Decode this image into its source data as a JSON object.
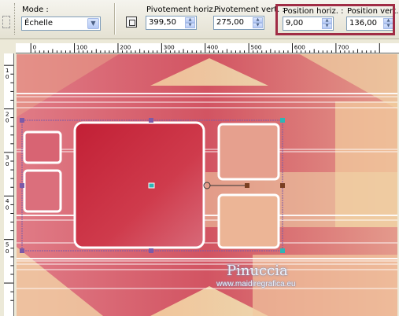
{
  "toolbar": {
    "mode_label": "Mode :",
    "mode_value": "Échelle",
    "pivot_h_label": "Pivotement horiz. :",
    "pivot_h_value": "399,50",
    "pivot_v_label": "Pivotement vert. :",
    "pivot_v_value": "275,00",
    "pos_h_label": "Position horiz. :",
    "pos_h_value": "9,00",
    "pos_v_label": "Position vert. :",
    "pos_v_value": "136,00"
  },
  "ruler": {
    "h_ticks": [
      "0",
      "100",
      "200",
      "300",
      "400",
      "500",
      "600",
      "700"
    ],
    "v_ticks": [
      "1",
      "0",
      "2",
      "0",
      "3",
      "0",
      "4",
      "0",
      "5",
      "0"
    ]
  },
  "watermark": {
    "title": "Pinuccia",
    "url": "www.maidiregrafica.eu"
  },
  "colors": {
    "highlight": "#a02c45",
    "canvas_base": "#d5636f",
    "frame_white": "#ffffff"
  }
}
